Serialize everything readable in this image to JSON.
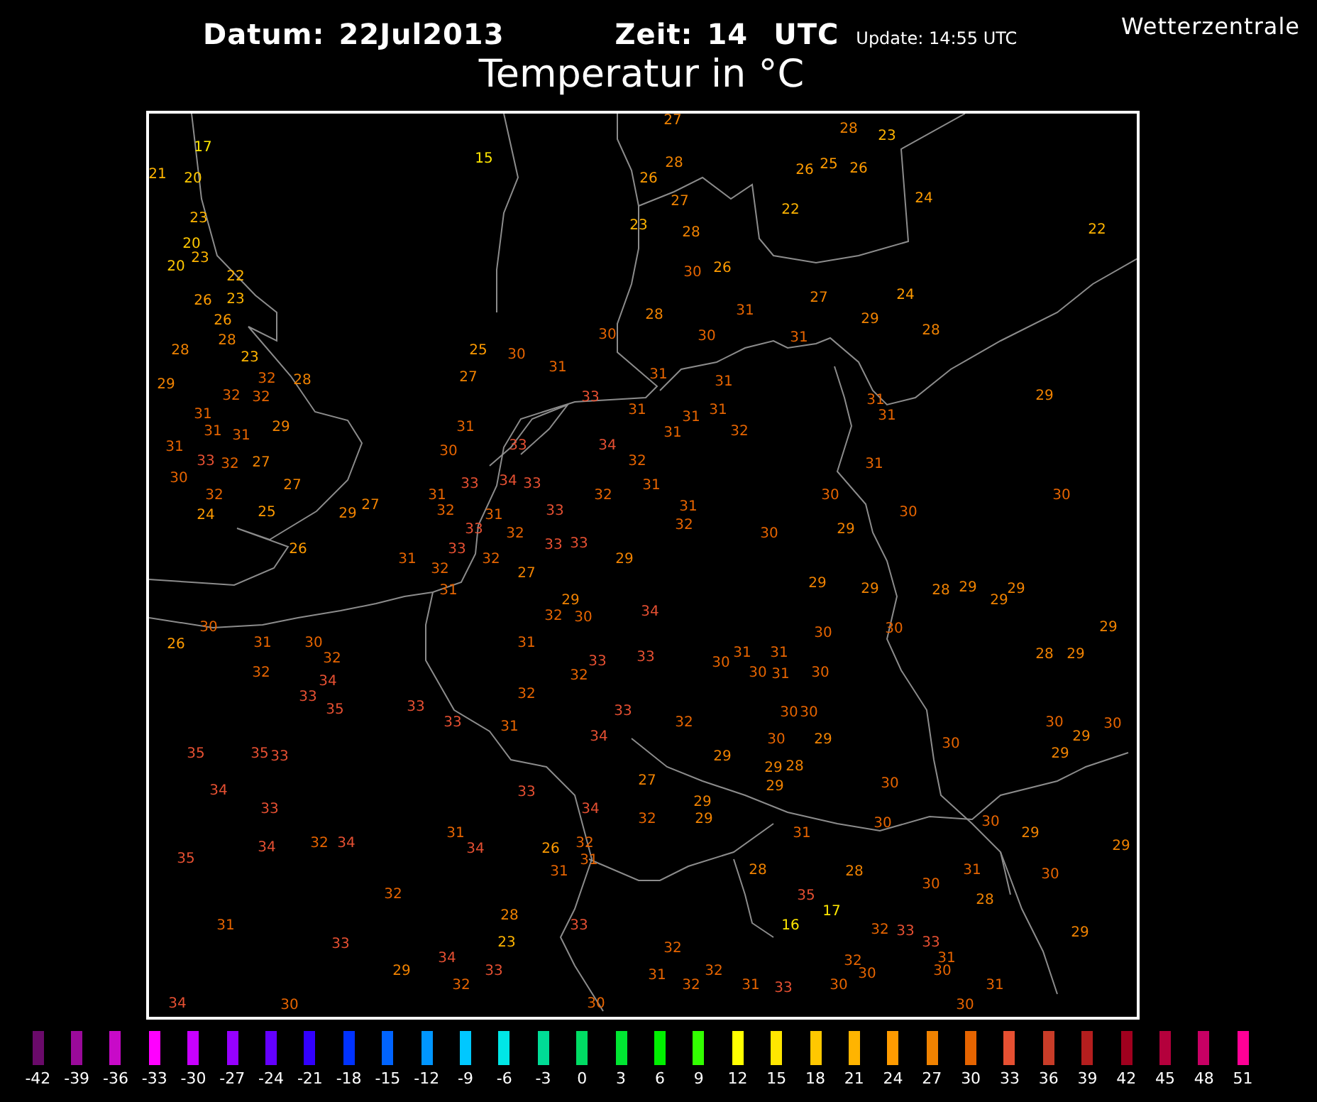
{
  "header": {
    "date_label": "Datum:",
    "date": "22Jul2013",
    "time_label": "Zeit:",
    "time": "14",
    "time_zone": "UTC",
    "update": "Update: 14:55 UTC",
    "source": "Wetterzentrale",
    "title": "Temperatur in °C"
  },
  "stations": [
    {
      "value": "27"
    },
    {
      "value": "28"
    },
    {
      "value": "23"
    },
    {
      "value": "17"
    },
    {
      "value": "21"
    },
    {
      "value": "20"
    },
    {
      "value": "15"
    },
    {
      "value": "26"
    },
    {
      "value": "28"
    },
    {
      "value": "26"
    },
    {
      "value": "25"
    },
    {
      "value": "26"
    },
    {
      "value": "23"
    },
    {
      "value": "23"
    },
    {
      "value": "27"
    },
    {
      "value": "28"
    },
    {
      "value": "22"
    },
    {
      "value": "24"
    },
    {
      "value": "22"
    },
    {
      "value": "20"
    },
    {
      "value": "20"
    },
    {
      "value": "23"
    },
    {
      "value": "22"
    },
    {
      "value": "30"
    },
    {
      "value": "26"
    },
    {
      "value": "26"
    },
    {
      "value": "23"
    },
    {
      "value": "27"
    },
    {
      "value": "24"
    },
    {
      "value": "26"
    },
    {
      "value": "28"
    },
    {
      "value": "31"
    },
    {
      "value": "29"
    },
    {
      "value": "28"
    },
    {
      "value": "30"
    },
    {
      "value": "30"
    },
    {
      "value": "31"
    },
    {
      "value": "28"
    },
    {
      "value": "28"
    },
    {
      "value": "23"
    },
    {
      "value": "25"
    },
    {
      "value": "30"
    },
    {
      "value": "29"
    },
    {
      "value": "32"
    },
    {
      "value": "28"
    },
    {
      "value": "27"
    },
    {
      "value": "31"
    },
    {
      "value": "31"
    },
    {
      "value": "31"
    },
    {
      "value": "32"
    },
    {
      "value": "32"
    },
    {
      "value": "33"
    },
    {
      "value": "31"
    },
    {
      "value": "29"
    },
    {
      "value": "31"
    },
    {
      "value": "31"
    },
    {
      "value": "31"
    },
    {
      "value": "31"
    },
    {
      "value": "31"
    },
    {
      "value": "31"
    },
    {
      "value": "31"
    },
    {
      "value": "29"
    },
    {
      "value": "31"
    },
    {
      "value": "31"
    },
    {
      "value": "32"
    },
    {
      "value": "31"
    },
    {
      "value": "30"
    },
    {
      "value": "33"
    },
    {
      "value": "34"
    },
    {
      "value": "33"
    },
    {
      "value": "32"
    },
    {
      "value": "27"
    },
    {
      "value": "32"
    },
    {
      "value": "31"
    },
    {
      "value": "30"
    },
    {
      "value": "27"
    },
    {
      "value": "33"
    },
    {
      "value": "34"
    },
    {
      "value": "33"
    },
    {
      "value": "31"
    },
    {
      "value": "32"
    },
    {
      "value": "31"
    },
    {
      "value": "32"
    },
    {
      "value": "30"
    },
    {
      "value": "30"
    },
    {
      "value": "24"
    },
    {
      "value": "25"
    },
    {
      "value": "29"
    },
    {
      "value": "27"
    },
    {
      "value": "32"
    },
    {
      "value": "31"
    },
    {
      "value": "33"
    },
    {
      "value": "31"
    },
    {
      "value": "30"
    },
    {
      "value": "33"
    },
    {
      "value": "32"
    },
    {
      "value": "32"
    },
    {
      "value": "30"
    },
    {
      "value": "29"
    },
    {
      "value": "26"
    },
    {
      "value": "33"
    },
    {
      "value": "33"
    },
    {
      "value": "33"
    },
    {
      "value": "31"
    },
    {
      "value": "32"
    },
    {
      "value": "29"
    },
    {
      "value": "32"
    },
    {
      "value": "27"
    },
    {
      "value": "31"
    },
    {
      "value": "29"
    },
    {
      "value": "29"
    },
    {
      "value": "28"
    },
    {
      "value": "29"
    },
    {
      "value": "29"
    },
    {
      "value": "29"
    },
    {
      "value": "29"
    },
    {
      "value": "32"
    },
    {
      "value": "30"
    },
    {
      "value": "34"
    },
    {
      "value": "30"
    },
    {
      "value": "30"
    },
    {
      "value": "30"
    },
    {
      "value": "29"
    },
    {
      "value": "26"
    },
    {
      "value": "31"
    },
    {
      "value": "30"
    },
    {
      "value": "31"
    },
    {
      "value": "32"
    },
    {
      "value": "33"
    },
    {
      "value": "33"
    },
    {
      "value": "30"
    },
    {
      "value": "31"
    },
    {
      "value": "31"
    },
    {
      "value": "28"
    },
    {
      "value": "29"
    },
    {
      "value": "32"
    },
    {
      "value": "34"
    },
    {
      "value": "32"
    },
    {
      "value": "30"
    },
    {
      "value": "31"
    },
    {
      "value": "30"
    },
    {
      "value": "33"
    },
    {
      "value": "32"
    },
    {
      "value": "35"
    },
    {
      "value": "33"
    },
    {
      "value": "33"
    },
    {
      "value": "30"
    },
    {
      "value": "30"
    },
    {
      "value": "33"
    },
    {
      "value": "31"
    },
    {
      "value": "32"
    },
    {
      "value": "30"
    },
    {
      "value": "30"
    },
    {
      "value": "34"
    },
    {
      "value": "30"
    },
    {
      "value": "29"
    },
    {
      "value": "30"
    },
    {
      "value": "29"
    },
    {
      "value": "35"
    },
    {
      "value": "35"
    },
    {
      "value": "33"
    },
    {
      "value": "29"
    },
    {
      "value": "29"
    },
    {
      "value": "29"
    },
    {
      "value": "28"
    },
    {
      "value": "34"
    },
    {
      "value": "33"
    },
    {
      "value": "27"
    },
    {
      "value": "29"
    },
    {
      "value": "30"
    },
    {
      "value": "33"
    },
    {
      "value": "34"
    },
    {
      "value": "29"
    },
    {
      "value": "32"
    },
    {
      "value": "29"
    },
    {
      "value": "30"
    },
    {
      "value": "30"
    },
    {
      "value": "31"
    },
    {
      "value": "31"
    },
    {
      "value": "29"
    },
    {
      "value": "34"
    },
    {
      "value": "32"
    },
    {
      "value": "34"
    },
    {
      "value": "34"
    },
    {
      "value": "26"
    },
    {
      "value": "32"
    },
    {
      "value": "29"
    },
    {
      "value": "35"
    },
    {
      "value": "31"
    },
    {
      "value": "31"
    },
    {
      "value": "28"
    },
    {
      "value": "28"
    },
    {
      "value": "31"
    },
    {
      "value": "30"
    },
    {
      "value": "30"
    },
    {
      "value": "32"
    },
    {
      "value": "35"
    },
    {
      "value": "28"
    },
    {
      "value": "28"
    },
    {
      "value": "17"
    },
    {
      "value": "31"
    },
    {
      "value": "33"
    },
    {
      "value": "16"
    },
    {
      "value": "32"
    },
    {
      "value": "33"
    },
    {
      "value": "29"
    },
    {
      "value": "33"
    },
    {
      "value": "23"
    },
    {
      "value": "32"
    },
    {
      "value": "33"
    },
    {
      "value": "34"
    },
    {
      "value": "32"
    },
    {
      "value": "31"
    },
    {
      "value": "29"
    },
    {
      "value": "33"
    },
    {
      "value": "31"
    },
    {
      "value": "32"
    },
    {
      "value": "30"
    },
    {
      "value": "30"
    },
    {
      "value": "32"
    },
    {
      "value": "32"
    },
    {
      "value": "31"
    },
    {
      "value": "33"
    },
    {
      "value": "30"
    },
    {
      "value": "31"
    },
    {
      "value": "34"
    },
    {
      "value": "30"
    },
    {
      "value": "30"
    },
    {
      "value": "30"
    }
  ],
  "legend": [
    {
      "label": "-42",
      "color": "#6a0a6a"
    },
    {
      "label": "-39",
      "color": "#9a0a9a"
    },
    {
      "label": "-36",
      "color": "#c80ac8"
    },
    {
      "label": "-33",
      "color": "#ff00ff"
    },
    {
      "label": "-30",
      "color": "#c800ff"
    },
    {
      "label": "-27",
      "color": "#9600ff"
    },
    {
      "label": "-24",
      "color": "#6400ff"
    },
    {
      "label": "-21",
      "color": "#3200ff"
    },
    {
      "label": "-18",
      "color": "#0032ff"
    },
    {
      "label": "-15",
      "color": "#0064ff"
    },
    {
      "label": "-12",
      "color": "#0096ff"
    },
    {
      "label": "-9",
      "color": "#00c8ff"
    },
    {
      "label": "-6",
      "color": "#00e6e6"
    },
    {
      "label": "-3",
      "color": "#00dc96"
    },
    {
      "label": "0",
      "color": "#00dc64"
    },
    {
      "label": "3",
      "color": "#00e632"
    },
    {
      "label": "6",
      "color": "#00f000"
    },
    {
      "label": "9",
      "color": "#32ff00"
    },
    {
      "label": "12",
      "color": "#ffff00"
    },
    {
      "label": "15",
      "color": "#ffe600"
    },
    {
      "label": "18",
      "color": "#ffc800"
    },
    {
      "label": "21",
      "color": "#ffb400"
    },
    {
      "label": "24",
      "color": "#ff9b00"
    },
    {
      "label": "27",
      "color": "#f08200"
    },
    {
      "label": "30",
      "color": "#e66400"
    },
    {
      "label": "33",
      "color": "#e65032"
    },
    {
      "label": "36",
      "color": "#c83c28"
    },
    {
      "label": "39",
      "color": "#b41e1e"
    },
    {
      "label": "42",
      "color": "#a0001e"
    },
    {
      "label": "45",
      "color": "#b4003c"
    },
    {
      "label": "48",
      "color": "#c80064"
    },
    {
      "label": "51",
      "color": "#ff0096"
    }
  ]
}
